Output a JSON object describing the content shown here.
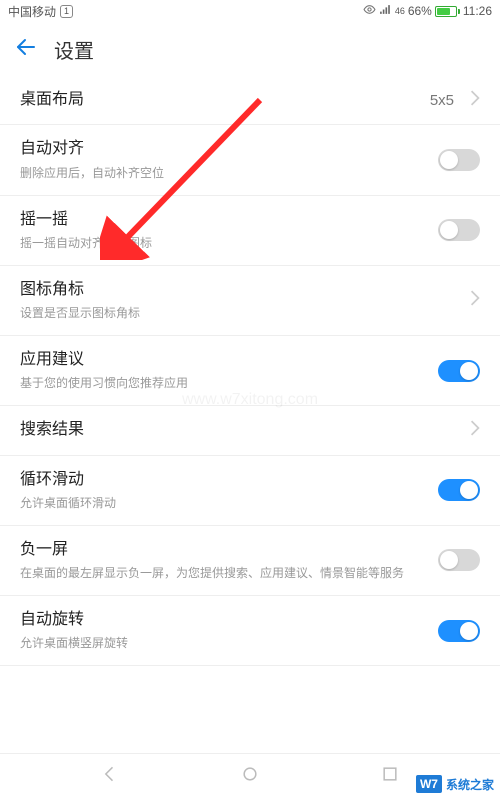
{
  "status": {
    "carrier": "中国移动",
    "sim": "1",
    "net": "46",
    "battery_pct": "66%",
    "time": "11:26"
  },
  "header": {
    "title": "设置"
  },
  "rows": {
    "layout": {
      "title": "桌面布局",
      "value": "5x5"
    },
    "align": {
      "title": "自动对齐",
      "sub": "删除应用后，自动补齐空位",
      "on": false
    },
    "shake": {
      "title": "摇一摇",
      "sub": "摇一摇自动对齐桌面图标",
      "on": false
    },
    "badge": {
      "title": "图标角标",
      "sub": "设置是否显示图标角标"
    },
    "suggest": {
      "title": "应用建议",
      "sub": "基于您的使用习惯向您推荐应用",
      "on": true
    },
    "search": {
      "title": "搜索结果"
    },
    "loop": {
      "title": "循环滑动",
      "sub": "允许桌面循环滑动",
      "on": true
    },
    "minus": {
      "title": "负一屏",
      "sub": "在桌面的最左屏显示负一屏，为您提供搜索、应用建议、情景智能等服务",
      "on": false
    },
    "rotate": {
      "title": "自动旋转",
      "sub": "允许桌面横竖屏旋转",
      "on": true
    }
  },
  "watermark": {
    "label": "W7",
    "text": "系统之家",
    "url": "www.w7xitong.com"
  }
}
